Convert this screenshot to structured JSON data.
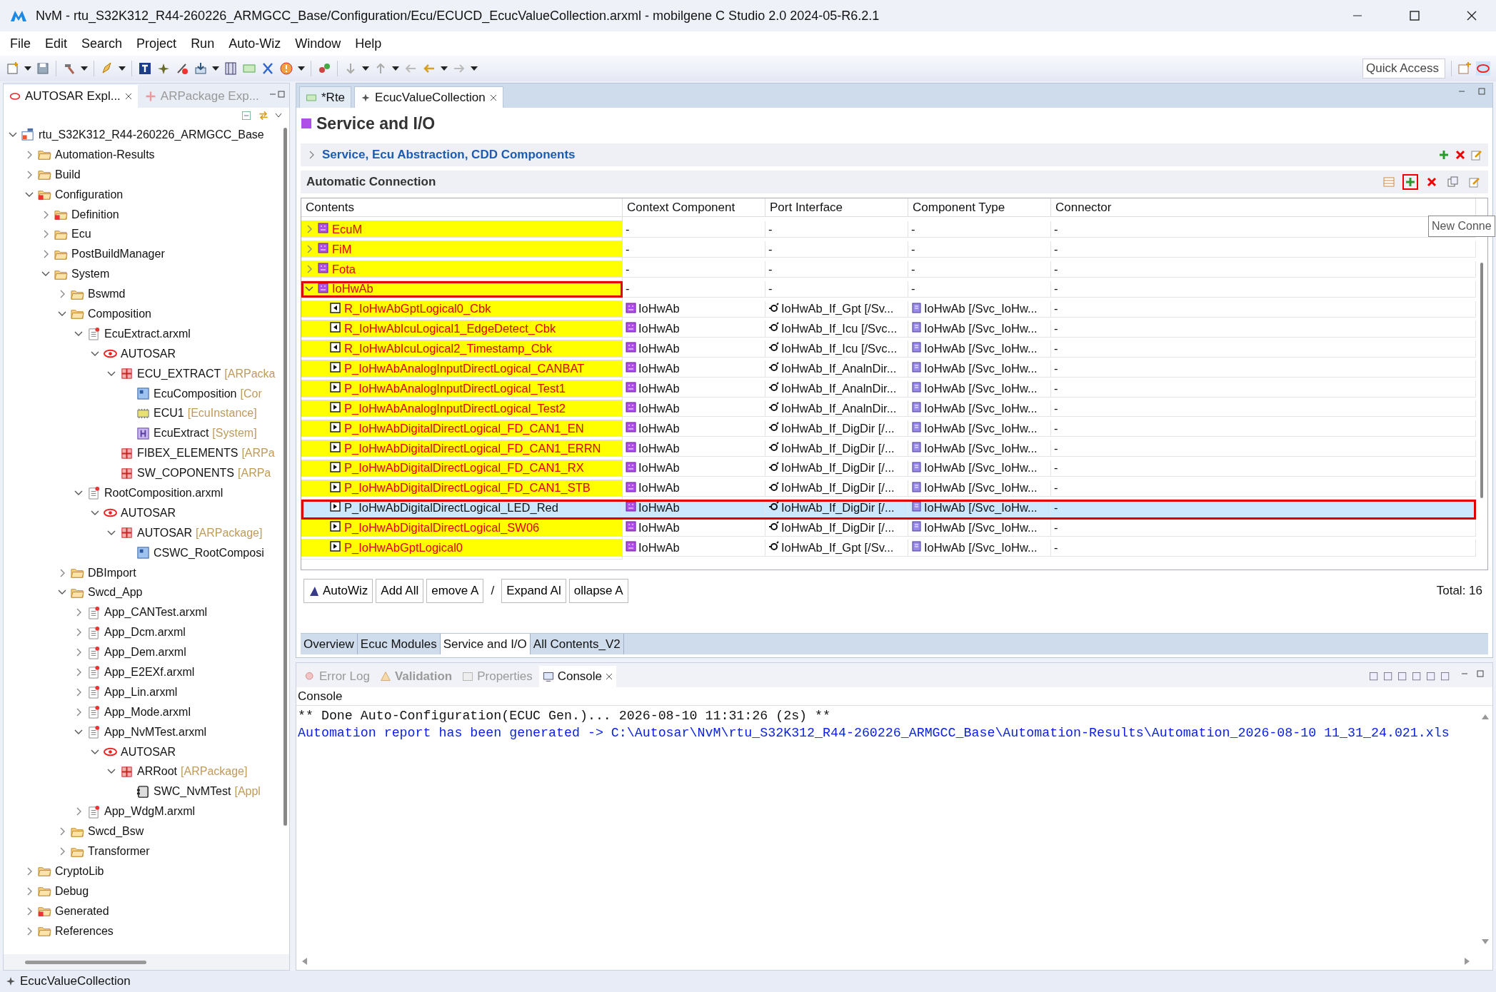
{
  "window": {
    "title": "NvM - rtu_S32K312_R44-260226_ARMGCC_Base/Configuration/Ecu/ECUCD_EcucValueCollection.arxml - mobilgene C Studio 2.0 2024-05-R6.2.1"
  },
  "menu": [
    "File",
    "Edit",
    "Search",
    "Project",
    "Run",
    "Auto-Wiz",
    "Window",
    "Help"
  ],
  "quick_access": {
    "placeholder": "Quick Access"
  },
  "left_tabs": [
    {
      "label": "AUTOSAR Expl...",
      "selected": true
    },
    {
      "label": "ARPackage Exp...",
      "selected": false
    }
  ],
  "tree": [
    {
      "label": "rtu_S32K312_R44-260226_ARMGCC_Base",
      "kind": "project",
      "expanded": true,
      "children": [
        {
          "label": "Automation-Results",
          "kind": "folder",
          "expanded": false
        },
        {
          "label": "Build",
          "kind": "folder",
          "expanded": false
        },
        {
          "label": "Configuration",
          "kind": "folder-error",
          "expanded": true,
          "children": [
            {
              "label": "Definition",
              "kind": "folder-error",
              "expanded": false
            },
            {
              "label": "Ecu",
              "kind": "folder",
              "expanded": false
            },
            {
              "label": "PostBuildManager",
              "kind": "folder",
              "expanded": false
            },
            {
              "label": "System",
              "kind": "folder",
              "expanded": true,
              "children": [
                {
                  "label": "Bswmd",
                  "kind": "folder",
                  "expanded": false
                },
                {
                  "label": "Composition",
                  "kind": "folder",
                  "expanded": true,
                  "children": [
                    {
                      "label": "EcuExtract.arxml",
                      "kind": "file",
                      "expanded": true,
                      "children": [
                        {
                          "label": "AUTOSAR",
                          "kind": "autosar",
                          "expanded": true,
                          "children": [
                            {
                              "label": "ECU_EXTRACT",
                              "suffix": "[ARPacka",
                              "kind": "package",
                              "expanded": true,
                              "children": [
                                {
                                  "label": "EcuComposition",
                                  "suffix": "[Cor",
                                  "kind": "composition"
                                },
                                {
                                  "label": "ECU1",
                                  "suffix": "[EcuInstance]",
                                  "kind": "ecu"
                                },
                                {
                                  "label": "EcuExtract",
                                  "suffix": "[System]",
                                  "kind": "system"
                                }
                              ]
                            },
                            {
                              "label": "FIBEX_ELEMENTS",
                              "suffix": "[ARPa",
                              "kind": "package"
                            },
                            {
                              "label": "SW_COPONENTS",
                              "suffix": "[ARPa",
                              "kind": "package"
                            }
                          ]
                        }
                      ]
                    },
                    {
                      "label": "RootComposition.arxml",
                      "kind": "file",
                      "expanded": true,
                      "children": [
                        {
                          "label": "AUTOSAR",
                          "kind": "autosar",
                          "expanded": true,
                          "children": [
                            {
                              "label": "AUTOSAR",
                              "suffix": "[ARPackage]",
                              "kind": "package",
                              "expanded": true,
                              "children": [
                                {
                                  "label": "CSWC_RootComposi",
                                  "kind": "composition"
                                }
                              ]
                            }
                          ]
                        }
                      ]
                    }
                  ]
                },
                {
                  "label": "DBImport",
                  "kind": "folder",
                  "expanded": false
                },
                {
                  "label": "Swcd_App",
                  "kind": "folder",
                  "expanded": true,
                  "children": [
                    {
                      "label": "App_CANTest.arxml",
                      "kind": "file",
                      "expanded": false
                    },
                    {
                      "label": "App_Dcm.arxml",
                      "kind": "file",
                      "expanded": false
                    },
                    {
                      "label": "App_Dem.arxml",
                      "kind": "file",
                      "expanded": false
                    },
                    {
                      "label": "App_E2EXf.arxml",
                      "kind": "file",
                      "expanded": false
                    },
                    {
                      "label": "App_Lin.arxml",
                      "kind": "file",
                      "expanded": false
                    },
                    {
                      "label": "App_Mode.arxml",
                      "kind": "file",
                      "expanded": false
                    },
                    {
                      "label": "App_NvMTest.arxml",
                      "kind": "file",
                      "expanded": true,
                      "children": [
                        {
                          "label": "AUTOSAR",
                          "kind": "autosar",
                          "expanded": true,
                          "children": [
                            {
                              "label": "ARRoot",
                              "suffix": "[ARPackage]",
                              "kind": "package",
                              "expanded": true,
                              "children": [
                                {
                                  "label": "SWC_NvMTest",
                                  "suffix": "[Appl",
                                  "kind": "swc"
                                }
                              ]
                            }
                          ]
                        }
                      ]
                    },
                    {
                      "label": "App_WdgM.arxml",
                      "kind": "file",
                      "expanded": false
                    }
                  ]
                },
                {
                  "label": "Swcd_Bsw",
                  "kind": "folder",
                  "expanded": false
                },
                {
                  "label": "Transformer",
                  "kind": "folder",
                  "expanded": false
                }
              ]
            }
          ]
        },
        {
          "label": "CryptoLib",
          "kind": "folder",
          "expanded": false
        },
        {
          "label": "Debug",
          "kind": "folder",
          "expanded": false
        },
        {
          "label": "Generated",
          "kind": "folder-error",
          "expanded": false
        },
        {
          "label": "References",
          "kind": "folder",
          "expanded": false
        }
      ]
    }
  ],
  "editor_tabs": [
    {
      "label": "*Rte",
      "selected": false
    },
    {
      "label": "EcucValueCollection",
      "selected": true
    }
  ],
  "page_title": "Service and I/O",
  "section": {
    "title": "Service, Ecu Abstraction, CDD Components",
    "expanded": false
  },
  "auto_connection": {
    "title": "Automatic Connection",
    "tooltip": "New Conne",
    "actions": [
      {
        "kind": "columns",
        "highlighted": false
      },
      {
        "kind": "add",
        "highlighted": true
      },
      {
        "kind": "delete",
        "highlighted": false
      },
      {
        "kind": "copy",
        "highlighted": false
      },
      {
        "kind": "edit",
        "highlighted": false
      }
    ],
    "columns": [
      "Contents",
      "Context Component",
      "Port Interface",
      "Component Type",
      "Connector"
    ],
    "rows": [
      {
        "kind": "group",
        "contents": "EcuM",
        "expanded": false,
        "outlined": false,
        "selected": false,
        "context": "-",
        "interface": "-",
        "type": "-",
        "connector": "-"
      },
      {
        "kind": "group",
        "contents": "FiM",
        "expanded": false,
        "outlined": false,
        "selected": false,
        "context": "-",
        "interface": "-",
        "type": "-",
        "connector": "-"
      },
      {
        "kind": "group",
        "contents": "Fota",
        "expanded": false,
        "outlined": false,
        "selected": false,
        "context": "-",
        "interface": "-",
        "type": "-",
        "connector": "-"
      },
      {
        "kind": "group",
        "contents": "IoHwAb",
        "expanded": true,
        "outlined": true,
        "selected": false,
        "context": "-",
        "interface": "-",
        "type": "-",
        "connector": "-"
      },
      {
        "kind": "r-port",
        "contents": "R_IoHwAbGptLogical0_Cbk",
        "outlined": false,
        "selected": false,
        "context": "IoHwAb",
        "interface": "IoHwAb_If_Gpt [/Sv...",
        "type": "IoHwAb [/Svc_IoHw...",
        "connector": "-"
      },
      {
        "kind": "r-port",
        "contents": "R_IoHwAbIcuLogical1_EdgeDetect_Cbk",
        "outlined": false,
        "selected": false,
        "context": "IoHwAb",
        "interface": "IoHwAb_If_Icu [/Svc...",
        "type": "IoHwAb [/Svc_IoHw...",
        "connector": "-"
      },
      {
        "kind": "r-port",
        "contents": "R_IoHwAbIcuLogical2_Timestamp_Cbk",
        "outlined": false,
        "selected": false,
        "context": "IoHwAb",
        "interface": "IoHwAb_If_Icu [/Svc...",
        "type": "IoHwAb [/Svc_IoHw...",
        "connector": "-"
      },
      {
        "kind": "p-port",
        "contents": "P_IoHwAbAnalogInputDirectLogical_CANBAT",
        "outlined": false,
        "selected": false,
        "context": "IoHwAb",
        "interface": "IoHwAb_If_AnalnDir...",
        "type": "IoHwAb [/Svc_IoHw...",
        "connector": "-"
      },
      {
        "kind": "p-port",
        "contents": "P_IoHwAbAnalogInputDirectLogical_Test1",
        "outlined": false,
        "selected": false,
        "context": "IoHwAb",
        "interface": "IoHwAb_If_AnalnDir...",
        "type": "IoHwAb [/Svc_IoHw...",
        "connector": "-"
      },
      {
        "kind": "p-port",
        "contents": "P_IoHwAbAnalogInputDirectLogical_Test2",
        "outlined": false,
        "selected": false,
        "context": "IoHwAb",
        "interface": "IoHwAb_If_AnalnDir...",
        "type": "IoHwAb [/Svc_IoHw...",
        "connector": "-"
      },
      {
        "kind": "p-port",
        "contents": "P_IoHwAbDigitalDirectLogical_FD_CAN1_EN",
        "outlined": false,
        "selected": false,
        "context": "IoHwAb",
        "interface": "IoHwAb_If_DigDir [/...",
        "type": "IoHwAb [/Svc_IoHw...",
        "connector": "-"
      },
      {
        "kind": "p-port",
        "contents": "P_IoHwAbDigitalDirectLogical_FD_CAN1_ERRN",
        "outlined": false,
        "selected": false,
        "context": "IoHwAb",
        "interface": "IoHwAb_If_DigDir [/...",
        "type": "IoHwAb [/Svc_IoHw...",
        "connector": "-"
      },
      {
        "kind": "p-port",
        "contents": "P_IoHwAbDigitalDirectLogical_FD_CAN1_RX",
        "outlined": false,
        "selected": false,
        "context": "IoHwAb",
        "interface": "IoHwAb_If_DigDir [/...",
        "type": "IoHwAb [/Svc_IoHw...",
        "connector": "-"
      },
      {
        "kind": "p-port",
        "contents": "P_IoHwAbDigitalDirectLogical_FD_CAN1_STB",
        "outlined": false,
        "selected": false,
        "context": "IoHwAb",
        "interface": "IoHwAb_If_DigDir [/...",
        "type": "IoHwAb [/Svc_IoHw...",
        "connector": "-"
      },
      {
        "kind": "p-port",
        "contents": "P_IoHwAbDigitalDirectLogical_LED_Red",
        "outlined": true,
        "selected": true,
        "context": "IoHwAb",
        "interface": "IoHwAb_If_DigDir [/...",
        "type": "IoHwAb [/Svc_IoHw...",
        "connector": "-"
      },
      {
        "kind": "p-port",
        "contents": "P_IoHwAbDigitalDirectLogical_SW06",
        "outlined": false,
        "selected": false,
        "context": "IoHwAb",
        "interface": "IoHwAb_If_DigDir [/...",
        "type": "IoHwAb [/Svc_IoHw...",
        "connector": "-"
      },
      {
        "kind": "p-port",
        "contents": "P_IoHwAbGptLogical0",
        "outlined": false,
        "selected": false,
        "context": "IoHwAb",
        "interface": "IoHwAb_If_Gpt [/Sv...",
        "type": "IoHwAb [/Svc_IoHw...",
        "connector": "-"
      }
    ]
  },
  "buttons": [
    {
      "label": "AutoWiz",
      "kind": "wizard"
    },
    {
      "label": "Add All",
      "kind": "plain"
    },
    {
      "label": "emove A",
      "kind": "plain"
    },
    {
      "label": "/",
      "kind": "separator"
    },
    {
      "label": "Expand Al",
      "kind": "plain"
    },
    {
      "label": "ollapse A",
      "kind": "plain"
    }
  ],
  "total": "Total: 16",
  "page_tabs": [
    {
      "label": "Overview",
      "selected": false
    },
    {
      "label": "Ecuc Modules",
      "selected": false
    },
    {
      "label": "Service and I/O",
      "selected": true
    },
    {
      "label": "All Contents_V2",
      "selected": false
    }
  ],
  "console_tabs": [
    {
      "label": "Error Log",
      "kind": "log",
      "selected": false
    },
    {
      "label": "Validation",
      "kind": "validation",
      "selected": false
    },
    {
      "label": "Properties",
      "kind": "properties",
      "selected": false
    },
    {
      "label": "Console",
      "kind": "console",
      "selected": true
    }
  ],
  "console": {
    "title": "Console",
    "lines": [
      {
        "kind": "plain",
        "text": "** Done Auto-Configuration(ECUC Gen.)... 2026-08-10 11:31:26 (2s) **"
      },
      {
        "kind": "report",
        "text": "Automation report has been generated -> C:\\Autosar\\NvM\\rtu_S32K312_R44-260226_ARMGCC_Base\\Automation-Results\\Automation_2026-08-10 11_31_24.021.xls"
      }
    ]
  },
  "status_bar": "EcucValueCollection"
}
